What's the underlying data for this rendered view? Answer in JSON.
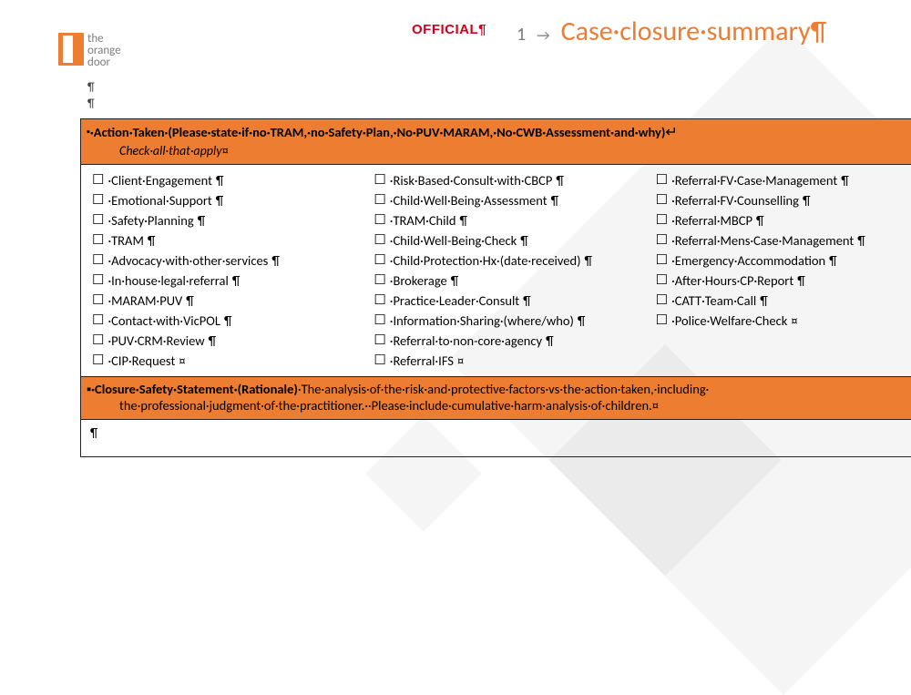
{
  "marks": {
    "pilcrow": "¶",
    "end_cell": "¤",
    "tab_arrow": "→",
    "newline_arrow": "↵",
    "dot": "·",
    "bullet": "▪"
  },
  "logo": {
    "line1": "the",
    "line2": "orange",
    "line3": "door"
  },
  "header": {
    "official": "OFFICIAL",
    "page_num": "1",
    "title": "Case·closure·summary"
  },
  "section_action": {
    "title": "·Action·Taken·(Please·state·if·no·TRAM,·no·Safety·Plan,·No·PUV·MARAM,·No·CWB·Assessment·and·why)",
    "subtitle": "Check·all·that·apply"
  },
  "checkbox_columns": [
    [
      "·Client·Engagement",
      "·Emotional·Support",
      "·Safety·Planning",
      "·TRAM",
      "·Advocacy·with·other·services",
      "·In·house·legal·referral",
      "·MARAM·PUV",
      "·Contact·with·VicPOL",
      "·PUV·CRM·Review",
      "·CIP·Request"
    ],
    [
      "·Risk·Based·Consult·with·CBCP",
      "·Child·Well·Being·Assessment",
      "·TRAM·Child",
      "·Child·Well-Being·Check",
      "·Child·Protection·Hx·(date·received)",
      "·Brokerage",
      "·Practice·Leader·Consult",
      "·Information·Sharing·(where/who)",
      "·Referral·to·non-core·agency",
      "·Referral·IFS"
    ],
    [
      "·Referral·FV·Case·Management",
      "·Referral·FV·Counselling",
      "·Referral·MBCP",
      "·Referral·Mens·Case·Management",
      "·Emergency·Accommodation",
      "·After·Hours·CP·Report",
      "·CATT·Team·Call",
      "·Police·Welfare·Check"
    ]
  ],
  "section_closure": {
    "title": "·Closure·Safety·Statement·(Rationale)",
    "body1": "·The·analysis·of·the·risk·and·protective·factors·vs·the·action·taken,·including·",
    "body2": "the·professional·judgment·of·the·practitioner.··Please·include·cumulative·harm·analysis·of·children."
  }
}
